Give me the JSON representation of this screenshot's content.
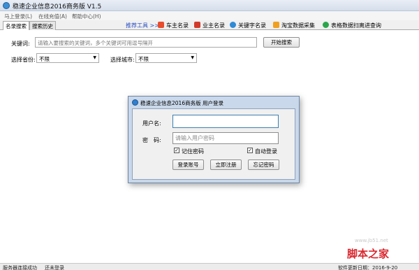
{
  "window": {
    "title": "稳速企业信息2016商务版 V1.5"
  },
  "menu": [
    {
      "label": "马上登录(L)"
    },
    {
      "label": "在线充值(A)"
    },
    {
      "label": "帮助中心(H)"
    }
  ],
  "tabs": [
    {
      "label": "名录搜索",
      "active": true
    },
    {
      "label": "搜索历史",
      "active": false
    }
  ],
  "toolbar": {
    "recommend_label": "推荐工具 >>",
    "tools": [
      {
        "label": "车主名录",
        "icon": "car-icon",
        "color": "#e74c2c"
      },
      {
        "label": "业主名录",
        "icon": "house-icon",
        "color": "#d23b2b"
      },
      {
        "label": "关键字名录",
        "icon": "magnifier-icon",
        "color": "#2f8ad6"
      },
      {
        "label": "淘宝数据采集",
        "icon": "taobao-icon",
        "color": "#f0a020"
      },
      {
        "label": "表格数据扫离进查询",
        "icon": "globe-icon",
        "color": "#2aa64a"
      }
    ]
  },
  "search": {
    "keyword_label": "关键词:",
    "keyword_placeholder": "请输入要搜索的关键词，多个关键词可用逗号隔开",
    "start_button": "开始搜索",
    "province_label": "选择省份:",
    "province_value": "不限",
    "city_label": "选择城市:",
    "city_value": "不限"
  },
  "login_dialog": {
    "title": "稳速企业信息2016商务版 用户登录",
    "username_label": "用户名:",
    "username_value": "",
    "password_label": "密　码:",
    "password_placeholder": "请输入用户密码",
    "remember_label": "记住密码",
    "remember_checked": true,
    "autologin_label": "自动登录",
    "autologin_checked": true,
    "login_button": "登录账号",
    "register_button": "立即注册",
    "forgot_button": "忘记密码"
  },
  "statusbar": {
    "server_status": "服务器连接成功",
    "login_status": "还未登录",
    "update_text": "软件更新日期：2016-9-20"
  },
  "watermark": {
    "site": "脚本之家",
    "url": "www.jb51.net"
  }
}
